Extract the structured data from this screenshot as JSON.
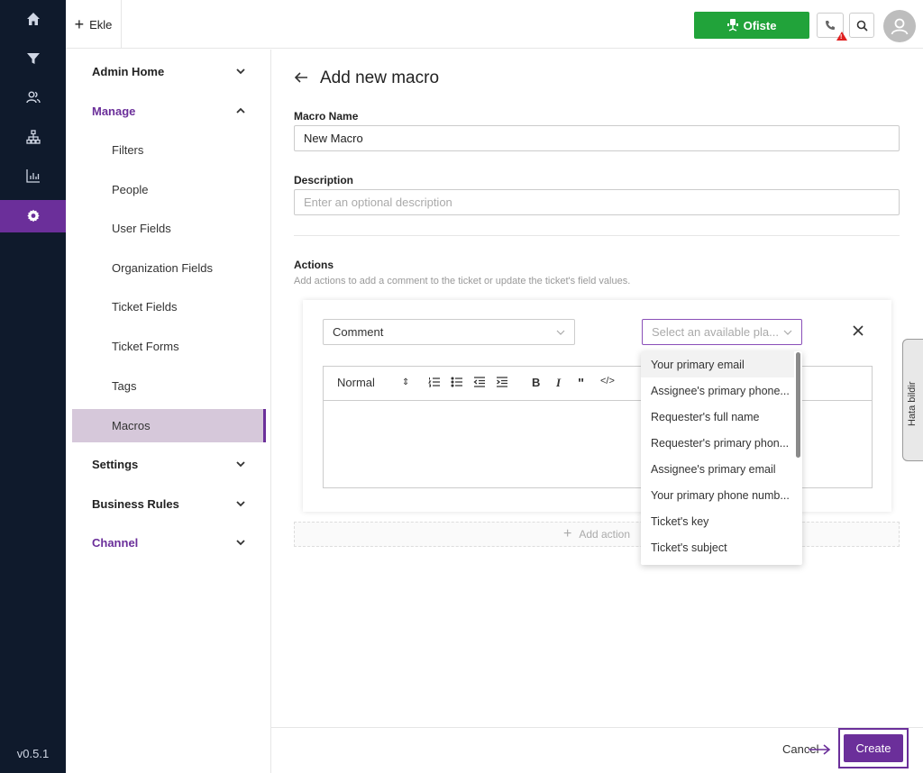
{
  "version": "v0.5.1",
  "rail": {
    "items": [
      "home-icon",
      "funnel-icon",
      "users-icon",
      "org-chart-icon",
      "bar-chart-icon",
      "gear-icon"
    ],
    "active_index": 5
  },
  "topbar": {
    "ekle_label": "Ekle",
    "status_label": "Ofiste",
    "status_color": "#21a33a"
  },
  "sidebar": {
    "items": [
      {
        "label": "Admin Home",
        "type": "header",
        "expanded": false
      },
      {
        "label": "Manage",
        "type": "header",
        "expanded": true,
        "accent": true
      },
      {
        "label": "Filters",
        "type": "sub"
      },
      {
        "label": "People",
        "type": "sub"
      },
      {
        "label": "User Fields",
        "type": "sub"
      },
      {
        "label": "Organization Fields",
        "type": "sub"
      },
      {
        "label": "Ticket Fields",
        "type": "sub"
      },
      {
        "label": "Ticket Forms",
        "type": "sub"
      },
      {
        "label": "Tags",
        "type": "sub"
      },
      {
        "label": "Macros",
        "type": "sub",
        "selected": true
      },
      {
        "label": "Settings",
        "type": "header",
        "expanded": false
      },
      {
        "label": "Business Rules",
        "type": "header",
        "expanded": false
      },
      {
        "label": "Channel",
        "type": "header",
        "expanded": false,
        "accent": true
      }
    ]
  },
  "main": {
    "title": "Add new macro",
    "macro_name_label": "Macro Name",
    "macro_name_value": "New Macro",
    "description_label": "Description",
    "description_placeholder": "Enter an optional description",
    "actions_label": "Actions",
    "actions_hint": "Add actions to add a comment to the ticket or update the ticket's field values.",
    "action_type": "Comment",
    "placeholder_select": "Select an available pla...",
    "editor_format": "Normal",
    "add_action_label": "Add action"
  },
  "dropdown": {
    "options": [
      "Your primary email",
      "Assignee's primary phone...",
      "Requester's full name",
      "Requester's primary phon...",
      "Assignee's primary email",
      "Your primary phone numb...",
      "Ticket's key",
      "Ticket's subject"
    ],
    "highlighted_index": 0
  },
  "feedback_tab": "Hata bildir",
  "footer": {
    "cancel_label": "Cancel",
    "create_label": "Create"
  },
  "accent_color": "#6b2f9a"
}
